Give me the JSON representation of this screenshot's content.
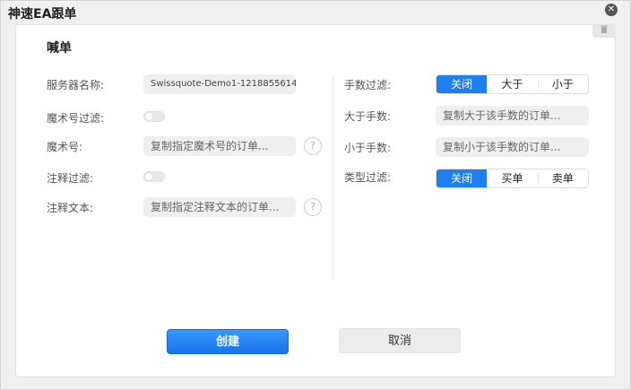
{
  "window": {
    "title": "神速EA跟单"
  },
  "section": {
    "title": "喊单"
  },
  "left": {
    "server_label": "服务器名称:",
    "server_value": "Swissquote-Demo1-1218855614",
    "magic_filter_label": "魔术号过滤:",
    "magic_label": "魔术号:",
    "magic_placeholder": "复制指定魔术号的订单...",
    "comment_filter_label": "注释过滤:",
    "comment_label": "注释文本:",
    "comment_placeholder": "复制指定注释文本的订单..."
  },
  "right": {
    "lot_filter_label": "手数过滤:",
    "lot_filter_options": [
      "关闭",
      "大于",
      "小于"
    ],
    "lot_filter_selected": 0,
    "greater_label": "大于手数:",
    "greater_placeholder": "复制大于该手数的订单...",
    "less_label": "小于手数:",
    "less_placeholder": "复制小于该手数的订单...",
    "type_filter_label": "类型过滤:",
    "type_filter_options": [
      "关闭",
      "买单",
      "卖单"
    ],
    "type_filter_selected": 0
  },
  "help_glyph": "?",
  "close_glyph": "✕",
  "trash_icon": "trash-icon",
  "buttons": {
    "create": "创建",
    "cancel": "取消"
  },
  "colors": {
    "accent": "#1e7ff0",
    "primary_button": "#1674ea"
  }
}
